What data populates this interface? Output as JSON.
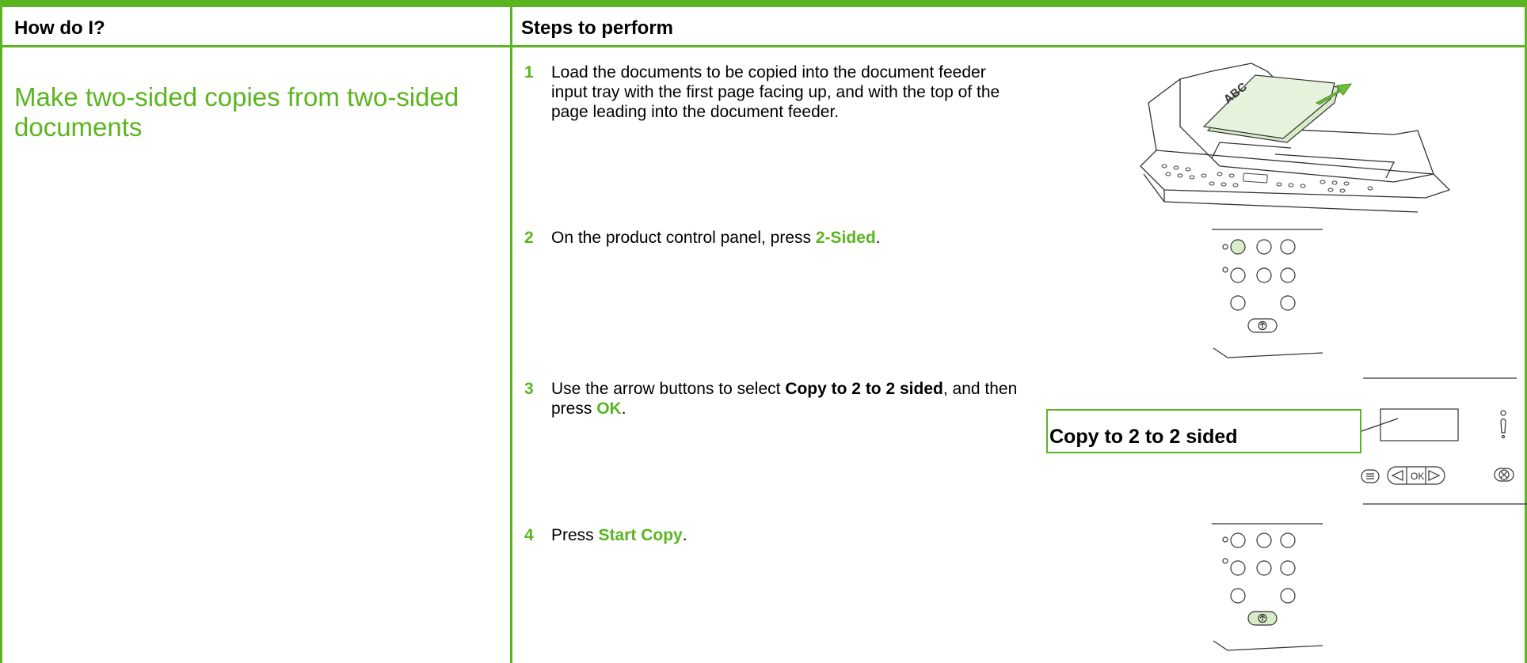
{
  "header": {
    "left": "How do I?",
    "right": "Steps to perform"
  },
  "task": {
    "title": "Make two-sided copies from two-sided documents"
  },
  "steps": [
    {
      "num": "1",
      "text": "Load the documents to be copied into the document feeder input tray with the first page facing up, and with the top of the page leading into the document feeder."
    },
    {
      "num": "2",
      "pre": "On the product control panel, press ",
      "highlight": "2-Sided",
      "post": "."
    },
    {
      "num": "3",
      "pre": "Use the arrow buttons to select ",
      "bold": "Copy to 2 to 2 sided",
      "mid": ", and then press ",
      "highlight": "OK",
      "post": "."
    },
    {
      "num": "4",
      "pre": "Press ",
      "highlight": "Start Copy",
      "post": "."
    }
  ],
  "illustrations": {
    "feeder_label": "ABC",
    "callout": "Copy to 2 to 2 sided",
    "ok_label": "OK"
  },
  "colors": {
    "accent": "#5bb520",
    "highlight_fill": "#d9ecc8"
  }
}
